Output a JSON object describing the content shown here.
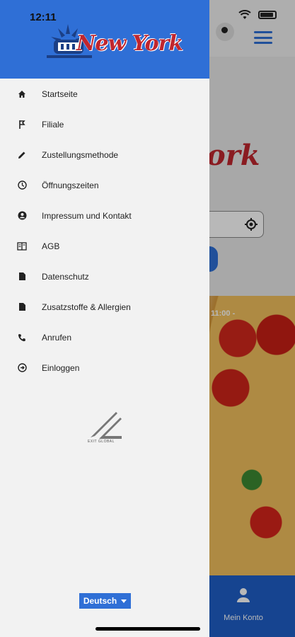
{
  "status_bar": {
    "time": "12:11"
  },
  "header": {
    "logo_text": "New York",
    "logo_icon": "statue-of-liberty-icon"
  },
  "menu": {
    "items": [
      {
        "label": "Startseite",
        "icon": "home-icon"
      },
      {
        "label": "Filiale",
        "icon": "branch-icon"
      },
      {
        "label": "Zustellungsmethode",
        "icon": "pencil-icon"
      },
      {
        "label": "Öffnungszeiten",
        "icon": "clock-icon"
      },
      {
        "label": "Impressum und Kontakt",
        "icon": "account-circle-icon"
      },
      {
        "label": "AGB",
        "icon": "book-icon"
      },
      {
        "label": "Datenschutz",
        "icon": "document-icon"
      },
      {
        "label": "Zusatzstoffe & Allergien",
        "icon": "document-icon"
      },
      {
        "label": "Anrufen",
        "icon": "phone-icon"
      },
      {
        "label": "Einloggen",
        "icon": "login-icon"
      }
    ]
  },
  "developer": {
    "logo_text": "EXIT GLOBAL"
  },
  "language": {
    "selected": "Deutsch"
  },
  "background": {
    "brand_text": "ork",
    "hours_text": "11:00 -",
    "bottom_nav_label": "Mein Konto"
  },
  "colors": {
    "primary": "#2f6fd6",
    "brand_red": "#c0262e",
    "drawer_bg": "#f2f2f2"
  }
}
